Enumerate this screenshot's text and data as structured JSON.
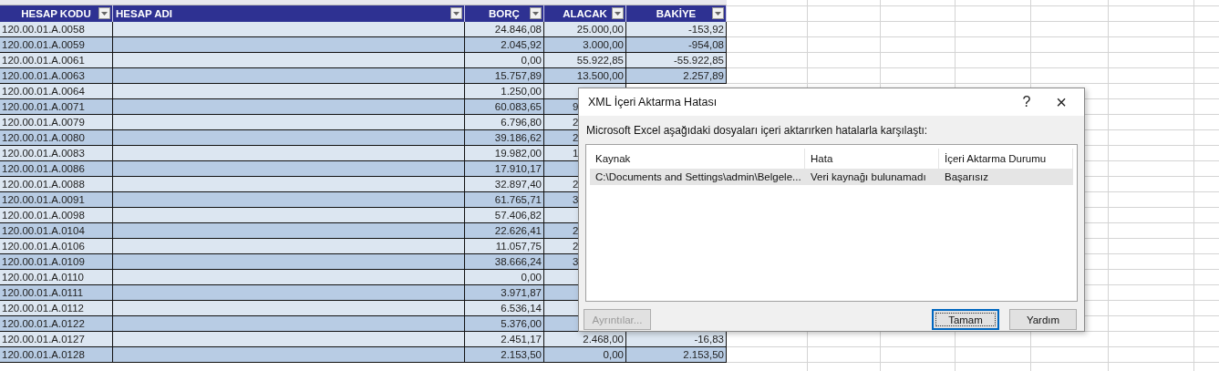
{
  "table": {
    "columns": [
      {
        "label": "HESAP KODU"
      },
      {
        "label": "HESAP ADI"
      },
      {
        "label": "BORÇ"
      },
      {
        "label": "ALACAK"
      },
      {
        "label": "BAKİYE"
      }
    ],
    "rows": [
      {
        "code": "120.00.01.A.0058",
        "borc": "24.846,08",
        "alacak": "25.000,00",
        "bakiye": "-153,92"
      },
      {
        "code": "120.00.01.A.0059",
        "borc": "2.045,92",
        "alacak": "3.000,00",
        "bakiye": "-954,08"
      },
      {
        "code": "120.00.01.A.0061",
        "borc": "0,00",
        "alacak": "55.922,85",
        "bakiye": "-55.922,85"
      },
      {
        "code": "120.00.01.A.0063",
        "borc": "15.757,89",
        "alacak": "13.500,00",
        "bakiye": "2.257,89"
      },
      {
        "code": "120.00.01.A.0064",
        "borc": "1.250,00"
      },
      {
        "code": "120.00.01.A.0071",
        "borc": "60.083,65",
        "alacak": "9"
      },
      {
        "code": "120.00.01.A.0079",
        "borc": "6.796,80",
        "alacak": "2"
      },
      {
        "code": "120.00.01.A.0080",
        "borc": "39.186,62",
        "alacak": "2"
      },
      {
        "code": "120.00.01.A.0083",
        "borc": "19.982,00",
        "alacak": "1"
      },
      {
        "code": "120.00.01.A.0086",
        "borc": "17.910,17"
      },
      {
        "code": "120.00.01.A.0088",
        "borc": "32.897,40",
        "alacak": "2"
      },
      {
        "code": "120.00.01.A.0091",
        "borc": "61.765,71",
        "alacak": "3"
      },
      {
        "code": "120.00.01.A.0098",
        "borc": "57.406,82"
      },
      {
        "code": "120.00.01.A.0104",
        "borc": "22.626,41",
        "alacak": "2"
      },
      {
        "code": "120.00.01.A.0106",
        "borc": "11.057,75",
        "alacak": "2"
      },
      {
        "code": "120.00.01.A.0109",
        "borc": "38.666,24",
        "alacak": "3"
      },
      {
        "code": "120.00.01.A.0110",
        "borc": "0,00"
      },
      {
        "code": "120.00.01.A.0111",
        "borc": "3.971,87"
      },
      {
        "code": "120.00.01.A.0112",
        "borc": "6.536,14"
      },
      {
        "code": "120.00.01.A.0122",
        "borc": "5.376,00"
      },
      {
        "code": "120.00.01.A.0127",
        "borc": "2.451,17",
        "alacak": "2.468,00",
        "bakiye": "-16,83"
      },
      {
        "code": "120.00.01.A.0128",
        "borc": "2.153,50",
        "alacak": "0,00",
        "bakiye": "2.153,50"
      }
    ]
  },
  "dialog": {
    "title": "XML İçeri Aktarma Hatası",
    "help": "?",
    "close": "×",
    "message": "Microsoft Excel aşağıdaki dosyaları içeri aktarırken hatalarla karşılaştı:",
    "columns": [
      "Kaynak",
      "Hata",
      "İçeri Aktarma Durumu"
    ],
    "items": [
      {
        "cells": [
          "C:\\Documents and Settings\\admin\\Belgele...",
          "Veri kaynağı bulunamadı",
          "Başarısız"
        ],
        "selected": true
      }
    ],
    "buttons": [
      {
        "label": "Ayrıntılar...",
        "disabled": true,
        "default": false
      },
      {
        "label": "Tamam",
        "disabled": false,
        "default": true
      },
      {
        "label": "Yardım",
        "disabled": false,
        "default": false
      }
    ]
  }
}
